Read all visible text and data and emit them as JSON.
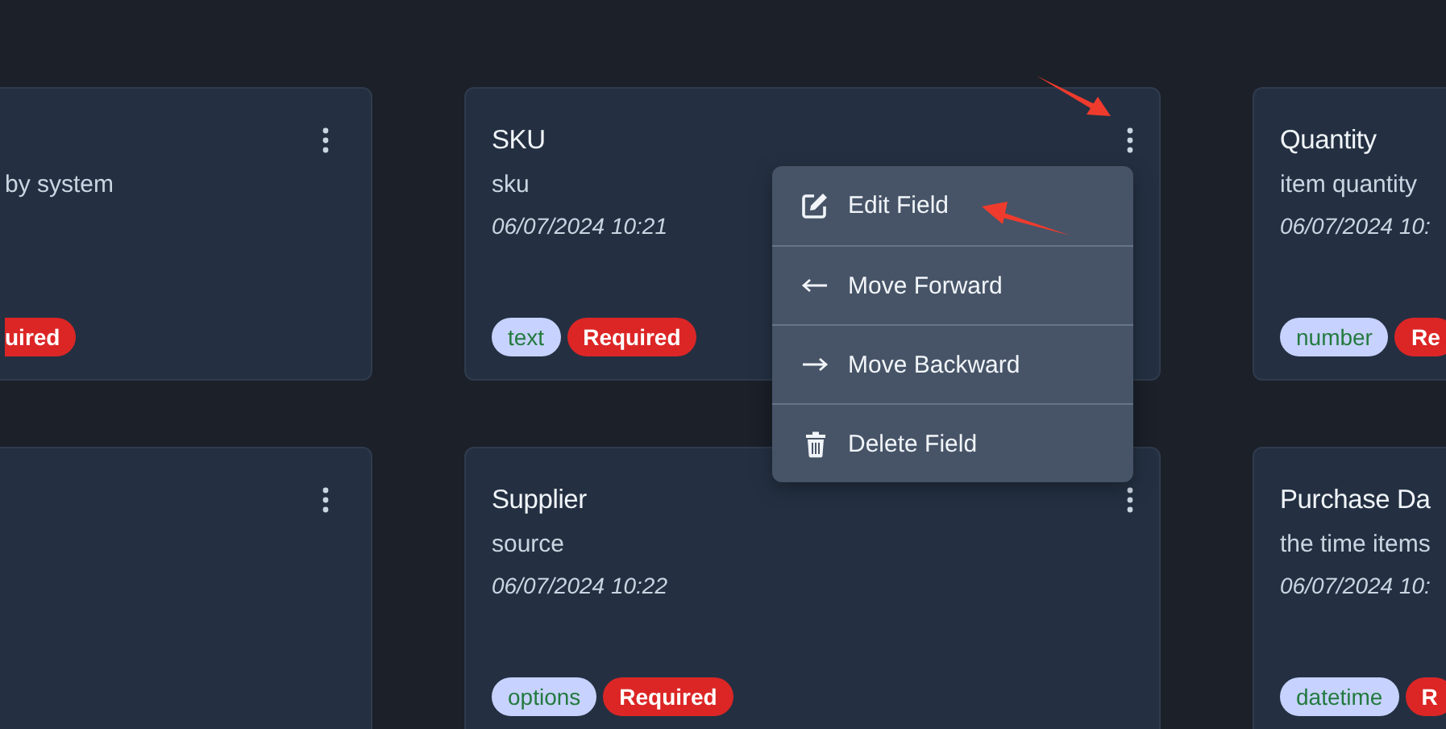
{
  "cards": [
    {
      "kind": "clipped-left",
      "description": "by system",
      "tags": [
        {
          "label": "uired",
          "kind": "required"
        }
      ]
    },
    {
      "kind": "full",
      "title": "SKU",
      "description": "sku",
      "date": "06/07/2024 10:21",
      "tags": [
        {
          "label": "text",
          "kind": "type"
        },
        {
          "label": "Required",
          "kind": "required"
        }
      ]
    },
    {
      "kind": "clipped-right",
      "title": "Quantity",
      "description": "item quantity",
      "date": "06/07/2024 10:",
      "tags": [
        {
          "label": "number",
          "kind": "type"
        },
        {
          "label": "Re",
          "kind": "required"
        }
      ]
    },
    {
      "kind": "clipped-left"
    },
    {
      "kind": "full",
      "title": "Supplier",
      "description": "source",
      "date": "06/07/2024 10:22",
      "tags": [
        {
          "label": "options",
          "kind": "type"
        },
        {
          "label": "Required",
          "kind": "required"
        }
      ]
    },
    {
      "kind": "clipped-right",
      "title": "Purchase Da",
      "description": "the time items",
      "date": "06/07/2024 10:",
      "tags": [
        {
          "label": "datetime",
          "kind": "type"
        },
        {
          "label": "R",
          "kind": "required"
        }
      ]
    }
  ],
  "context_menu": {
    "items": [
      {
        "label": "Edit Field",
        "kind": "edit"
      },
      {
        "label": "Move Forward",
        "kind": "forward"
      },
      {
        "label": "Move Backward",
        "kind": "backward"
      },
      {
        "label": "Delete Field",
        "kind": "delete"
      }
    ]
  }
}
